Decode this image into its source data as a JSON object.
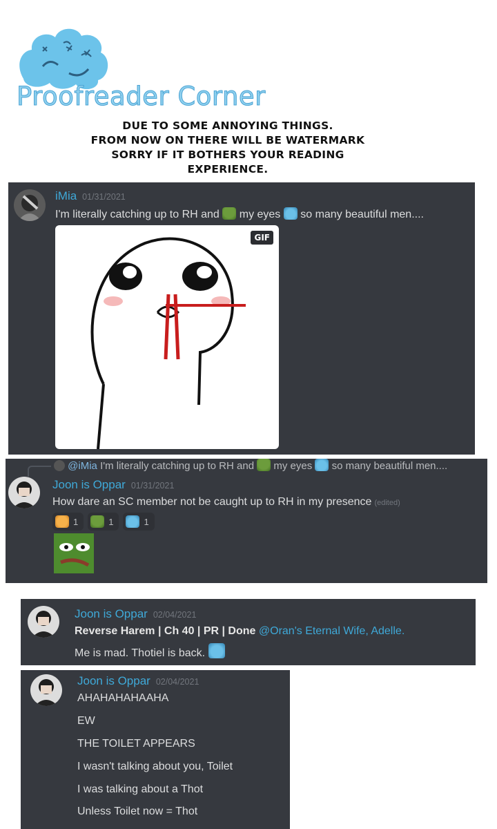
{
  "header": {
    "title": "Proofreader Corner",
    "notice_lines": [
      "DUE TO SOME ANNOYING THINGS.",
      "FROM NOW ON THERE WILL BE WATERMARK",
      "SORRY IF IT BOTHERS YOUR READING",
      "EXPERIENCE."
    ]
  },
  "post1": {
    "author": "iMia",
    "timestamp": "01/31/2021",
    "text_a": "I'm literally catching up to RH and",
    "text_b": "my eyes",
    "text_c": "so many beautiful men....",
    "gif_badge": "GIF"
  },
  "post2": {
    "reply_mention": "@iMia",
    "reply_text_a": "I'm literally catching up to RH and",
    "reply_text_b": "my eyes",
    "reply_text_c": "so many beautiful men....",
    "author": "Joon is Oppar",
    "timestamp": "01/31/2021",
    "text": "How dare an SC member not be caught up to RH in my presence",
    "edited": "(edited)",
    "reactions": [
      {
        "emoji": "bread-emoji",
        "count": "1"
      },
      {
        "emoji": "pepe-emoji",
        "count": "1"
      },
      {
        "emoji": "crying-emoji",
        "count": "1"
      }
    ]
  },
  "post3": {
    "author": "Joon is Oppar",
    "timestamp": "02/04/2021",
    "bold_line": "Reverse Harem | Ch 40 | PR | Done",
    "mention": "@Oran's Eternal Wife, Adelle.",
    "text": "Me is mad. Thotiel is back."
  },
  "post4": {
    "author": "Joon is Oppar",
    "timestamp": "02/04/2021",
    "lines": [
      "AHAHAHAHAAHA",
      "EW",
      "THE TOILET APPEARS",
      "I wasn't talking about you, Toilet",
      "I was talking about a Thot",
      "Unless Toilet now = Thot"
    ]
  },
  "colors": {
    "discord_bg": "#36393f",
    "username": "#3fa9d8",
    "title_blue": "#8fd0ee"
  }
}
